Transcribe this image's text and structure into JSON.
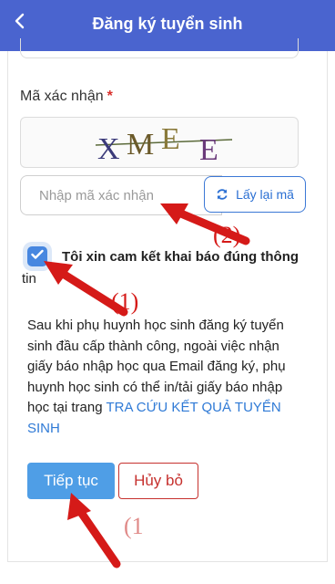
{
  "header": {
    "title": "Đăng ký tuyển sinh",
    "back_icon": "chevron-left-icon"
  },
  "captcha": {
    "label": "Mã xác nhận",
    "required_mark": "*",
    "code_text": "XMEE",
    "input_placeholder": "Nhập mã xác nhận",
    "input_value": "",
    "refresh_label": "Lấy lại mã",
    "refresh_icon": "refresh-icon"
  },
  "commitment": {
    "checked": true,
    "text_bold": "Tôi xin cam kết khai báo đúng thông",
    "text_cont": "tin"
  },
  "note": {
    "text": "Sau khi phụ huynh học sinh đăng ký tuyển sinh đầu cấp thành công, ngoài việc nhận giấy báo nhập học qua Email đăng ký, phụ huynh học sinh có thể in/tải giấy báo nhập học tại trang ",
    "link_text": "TRA CỨU KẾT QUẢ TUYỂN SINH"
  },
  "actions": {
    "continue_label": "Tiếp tục",
    "cancel_label": "Hủy bỏ"
  },
  "annotations": {
    "label_1": "(1)",
    "label_2": "(2)",
    "label_3": "(1"
  },
  "colors": {
    "header": "#4a64cf",
    "primary": "#4f9ee6",
    "danger": "#c6312e",
    "link": "#2f7ad6",
    "arrow": "#d51a18"
  }
}
